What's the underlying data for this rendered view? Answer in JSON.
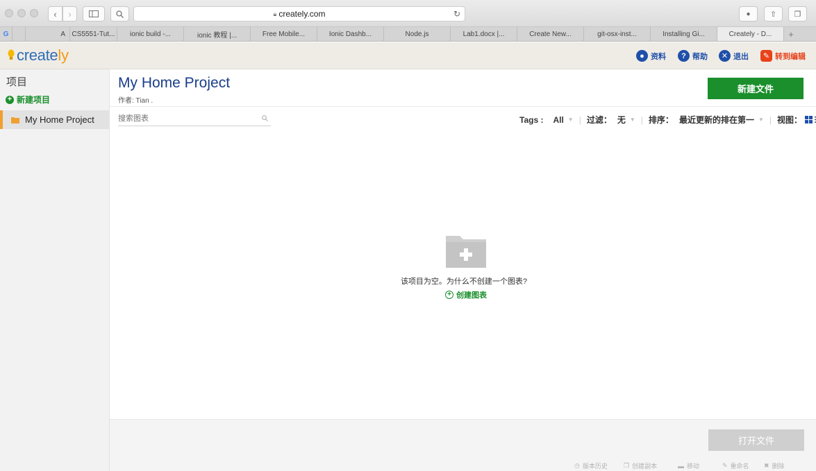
{
  "browser": {
    "url": "creately.com",
    "tabs": [
      "G",
      "",
      "A",
      "CS5551-Tut...",
      "ionic build -...",
      "ionic 教程 |...",
      "Free Mobile...",
      "Ionic Dashb...",
      "Node.js",
      "Lab1.docx |...",
      "Create New...",
      "git-osx-inst...",
      "Installing Gi...",
      "Creately - D...",
      "+"
    ],
    "active_tab_index": 13
  },
  "header": {
    "logo_prefix": "create",
    "logo_suffix": "ly",
    "profile": "资料",
    "help": "帮助",
    "logout": "退出",
    "goto_editor": "转到编辑",
    "colors": {
      "profile": "#1f4fa8",
      "help": "#1f4fa8",
      "logout": "#1f4fa8",
      "goto_editor": "#e8421a",
      "brand_orange": "#f39c12",
      "brand_blue": "#2f6db5",
      "green": "#1a8f2c"
    }
  },
  "sidebar": {
    "title": "项目",
    "new_project": "新建项目",
    "project_item": "My Home Project"
  },
  "main": {
    "title": "My Home Project",
    "author": "作者: Tian .",
    "new_file_button": "新建文件",
    "search_placeholder": "搜索图表",
    "filter_bar": {
      "tags_label": "Tags :",
      "tags_value": "All",
      "filter_label": "过滤：",
      "filter_value": "无",
      "sort_label": "排序：",
      "sort_value": "最近更新的排在第一",
      "view_label": "视图："
    },
    "empty_message": "该项目为空。为什么不创建一个图表?",
    "create_chart": "创建图表"
  },
  "footer": {
    "open_file_button": "打开文件",
    "actions": [
      "版本历史",
      "创建副本",
      "移动",
      "重命名",
      "删除"
    ]
  }
}
